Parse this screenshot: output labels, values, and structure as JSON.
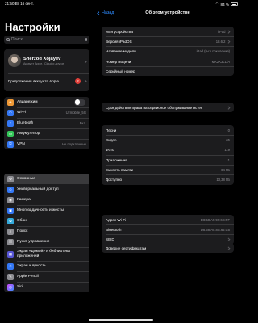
{
  "status": {
    "time": "21:50",
    "date": "Вт 16 сент.",
    "battery": "84 %"
  },
  "sidebar": {
    "title": "Настройки",
    "search_placeholder": "Поиск",
    "profile": {
      "name": "Sherzod Xojayev",
      "subtitle": "Аккаунт Apple, iCloud и другое",
      "suggestions": "Предложения Аккаунта Apple",
      "badge": "2"
    },
    "connectivity": [
      {
        "label": "Авиарежим",
        "icon": "airplane-icon",
        "color": "#f09a37",
        "toggle": false
      },
      {
        "label": "Wi-Fi",
        "value": "Uzmobile_5G",
        "icon": "wifi-icon",
        "color": "#3478f6"
      },
      {
        "label": "Bluetooth",
        "value": "Вкл.",
        "icon": "bluetooth-icon",
        "color": "#3478f6"
      },
      {
        "label": "Аккумулятор",
        "icon": "battery-icon",
        "color": "#34c759"
      },
      {
        "label": "VPN",
        "value": "Не подключено",
        "icon": "vpn-icon",
        "color": "#3478f6"
      }
    ],
    "general": [
      {
        "label": "Основные",
        "icon": "gear-icon",
        "color": "#8e8e93",
        "selected": true
      },
      {
        "label": "Универсальный доступ",
        "icon": "accessibility-icon",
        "color": "#3478f6"
      },
      {
        "label": "Камера",
        "icon": "camera-icon",
        "color": "#8e8e93"
      },
      {
        "label": "Многозадачность и жесты",
        "icon": "multitasking-icon",
        "color": "#3478f6"
      },
      {
        "label": "Обои",
        "icon": "wallpaper-icon",
        "color": "#35aadc"
      },
      {
        "label": "Поиск",
        "icon": "search-icon",
        "color": "#8e8e93"
      },
      {
        "label": "Пункт управления",
        "icon": "control-center-icon",
        "color": "#8e8e93"
      },
      {
        "label": "Экран «Домой» и библиотека приложений",
        "icon": "home-screen-icon",
        "color": "#5856d6"
      },
      {
        "label": "Экран и яркость",
        "icon": "brightness-icon",
        "color": "#3478f6"
      },
      {
        "label": "Apple Pencil",
        "icon": "pencil-icon",
        "color": "#8e8e93"
      },
      {
        "label": "Siri",
        "icon": "siri-icon",
        "color": "#1c1c1e"
      }
    ]
  },
  "detail": {
    "back_label": "Назад",
    "title": "Об этом устройстве",
    "group1": [
      {
        "label": "Имя устройства",
        "value": "iPad",
        "chevron": true
      },
      {
        "label": "Версия iPadOS",
        "value": "18.6.2",
        "chevron": true
      },
      {
        "label": "Название модели",
        "value": "iPad (9-го поколения)"
      },
      {
        "label": "Номер модели",
        "value": "MK2K3LL/A"
      },
      {
        "label": "Серийный номер",
        "value": ""
      }
    ],
    "warranty": {
      "label": "Срок действия права на сервисное обслуживание истек",
      "chevron": true
    },
    "group2": [
      {
        "label": "Песни",
        "value": "0"
      },
      {
        "label": "Видео",
        "value": "65"
      },
      {
        "label": "Фото",
        "value": "119"
      },
      {
        "label": "Приложения",
        "value": "11"
      },
      {
        "label": "Емкость памяти",
        "value": "64 ГБ"
      },
      {
        "label": "Доступно",
        "value": "13,38 ГБ"
      }
    ],
    "group3": [
      {
        "label": "Адрес Wi-Fi",
        "value": "D8:58:A5:92:6C:FF"
      },
      {
        "label": "Bluetooth",
        "value": "D8:58:A5:8B:65:C6"
      },
      {
        "label": "SEID",
        "value": "",
        "chevron": true
      }
    ],
    "certificates": {
      "label": "Доверие сертификатам",
      "chevron": true
    }
  }
}
